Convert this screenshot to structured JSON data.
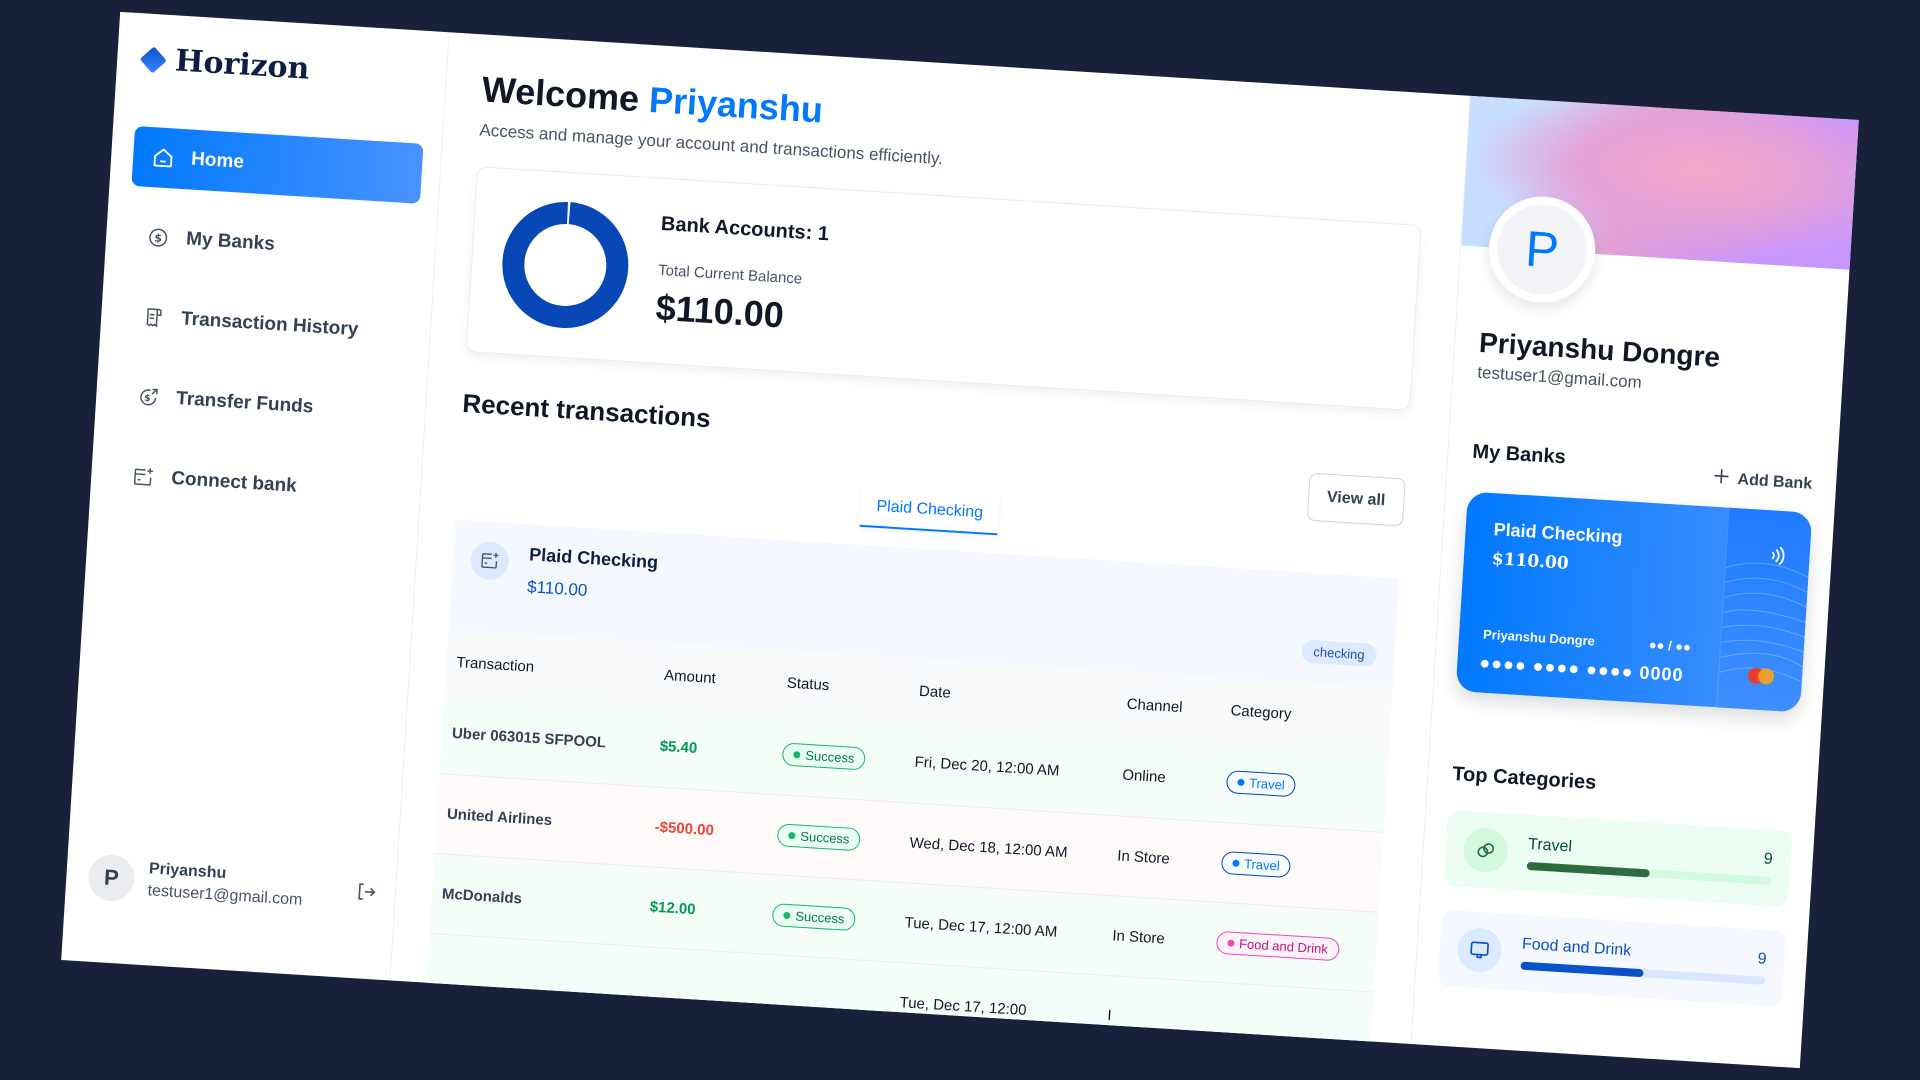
{
  "app": {
    "name": "Horizon",
    "brand_color": "#0179FE",
    "background_color": "#19203A"
  },
  "sidebar": {
    "items": [
      {
        "label": "Home",
        "icon": "home-icon",
        "active": true
      },
      {
        "label": "My Banks",
        "icon": "dollar-circle-icon",
        "active": false
      },
      {
        "label": "Transaction History",
        "icon": "receipt-icon",
        "active": false
      },
      {
        "label": "Transfer Funds",
        "icon": "money-send-icon",
        "active": false
      },
      {
        "label": "Connect bank",
        "icon": "connect-bank-icon",
        "active": false
      }
    ],
    "user": {
      "initial": "P",
      "name": "Priyanshu",
      "email": "testuser1@gmail.com",
      "logout_icon": "logout-icon"
    }
  },
  "header": {
    "greeting": "Welcome",
    "user_first_name": "Priyanshu",
    "subtitle": "Access and manage your account and transactions efficiently."
  },
  "balance_card": {
    "bank_accounts_label": "Bank Accounts: 1",
    "total_label": "Total Current Balance",
    "total_value": "$110.00",
    "chart_data": {
      "type": "pie",
      "style": "doughnut",
      "categories": [
        "Plaid Checking"
      ],
      "values": [
        110.0
      ],
      "colors": [
        "#0747B6"
      ]
    }
  },
  "recent": {
    "title": "Recent transactions",
    "view_all_label": "View all",
    "tabs": [
      {
        "label": "Plaid Checking",
        "active": true
      }
    ],
    "account": {
      "name": "Plaid Checking",
      "balance": "$110.00",
      "type": "checking"
    },
    "columns": [
      "Transaction",
      "Amount",
      "Status",
      "Date",
      "Channel",
      "Category"
    ],
    "rows": [
      {
        "name": "Uber 063015 SFPOOL",
        "amount": "$5.40",
        "type": "credit",
        "status": "Success",
        "date": "Fri, Dec 20, 12:00 AM",
        "channel": "Online",
        "category": "Travel",
        "category_style": "travel"
      },
      {
        "name": "United Airlines",
        "amount": "-$500.00",
        "type": "debit",
        "status": "Success",
        "date": "Wed, Dec 18, 12:00 AM",
        "channel": "In Store",
        "category": "Travel",
        "category_style": "travel"
      },
      {
        "name": "McDonalds",
        "amount": "$12.00",
        "type": "credit",
        "status": "Success",
        "date": "Tue, Dec 17, 12:00 AM",
        "channel": "In Store",
        "category": "Food and Drink",
        "category_style": "food"
      },
      {
        "name": "",
        "amount": "",
        "type": "credit",
        "status": "",
        "date": "Tue, Dec 17, 12:00",
        "channel": "I",
        "category": "",
        "category_style": "food"
      }
    ]
  },
  "right_panel": {
    "profile": {
      "initial": "P",
      "full_name": "Priyanshu Dongre",
      "email": "testuser1@gmail.com"
    },
    "my_banks": {
      "title": "My Banks",
      "add_label": "Add Bank",
      "card": {
        "name": "Plaid Checking",
        "balance": "$110.00",
        "holder": "Priyanshu Dongre",
        "expiry": "●● / ●●",
        "number": "●●●● ●●●● ●●●● 0000"
      }
    },
    "top_categories": {
      "title": "Top Categories",
      "items": [
        {
          "name": "Travel",
          "count": "9",
          "progress_percent": 50,
          "icon": "link-circles-icon",
          "theme": "green"
        },
        {
          "name": "Food and Drink",
          "count": "9",
          "progress_percent": 50,
          "icon": "monitor-icon",
          "theme": "blue"
        }
      ]
    }
  }
}
